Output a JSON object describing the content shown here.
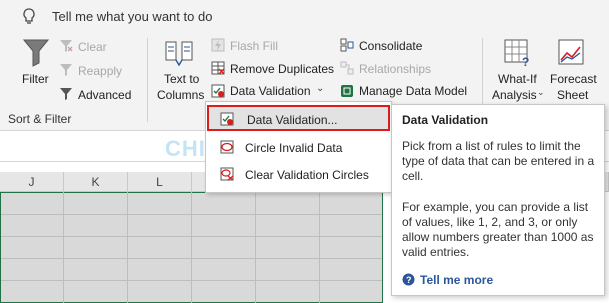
{
  "tell_me": {
    "placeholder": "Tell me what you want to do",
    "icon": "lightbulb-icon"
  },
  "sort_filter": {
    "group_label": "Sort & Filter",
    "filter": "Filter",
    "clear": "Clear",
    "reapply": "Reapply",
    "advanced": "Advanced"
  },
  "data_tools": {
    "text_to_columns": [
      "Text to",
      "Columns"
    ],
    "flash_fill": "Flash Fill",
    "remove_duplicates": "Remove Duplicates",
    "data_validation": "Data Validation",
    "consolidate": "Consolidate",
    "relationships": "Relationships",
    "manage_data_model": "Manage Data Model"
  },
  "forecast": {
    "what_if": [
      "What-If",
      "Analysis"
    ],
    "forecast_sheet": [
      "Forecast",
      "Sheet"
    ]
  },
  "dropdown_menu": {
    "items": [
      "Data Validation...",
      "Circle Invalid Data",
      "Clear Validation Circles"
    ]
  },
  "tooltip": {
    "title": "Data Validation",
    "para1": "Pick from a list of rules to limit the type of data that can be entered in a cell.",
    "para2": "For example, you can provide a list of values, like 1, 2, and 3, or only allow numbers greater than 1000 as valid entries.",
    "link": "Tell me more"
  },
  "sheet": {
    "columns": [
      "J",
      "K",
      "L"
    ]
  },
  "watermark": "CHIA SẺ KIẾN THỨC",
  "colors": {
    "highlight_border": "#d91e1e",
    "link": "#2b579a",
    "accent_green": "#217346"
  }
}
